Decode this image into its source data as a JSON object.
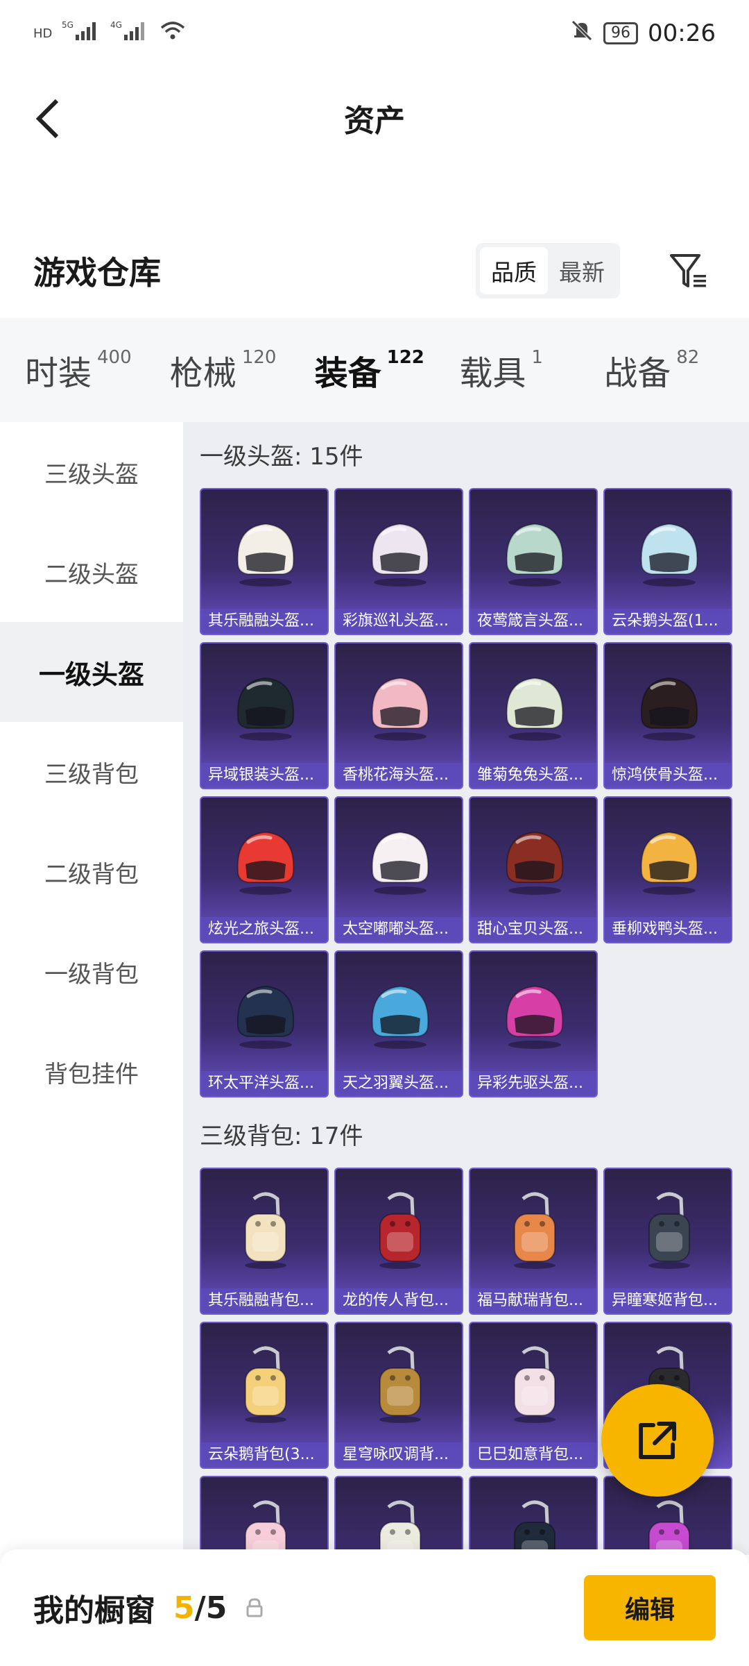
{
  "status_bar": {
    "left_tags": [
      "HD",
      "5G",
      "4G"
    ],
    "battery": "96",
    "time": "00:26"
  },
  "header": {
    "title": "资产"
  },
  "warehouse": {
    "title": "游戏仓库",
    "sort_options": [
      "品质",
      "最新"
    ],
    "active_sort": "品质"
  },
  "tabs": [
    {
      "label": "时装",
      "count": "400"
    },
    {
      "label": "枪械",
      "count": "120"
    },
    {
      "label": "装备",
      "count": "122"
    },
    {
      "label": "载具",
      "count": "1"
    },
    {
      "label": "战备",
      "count": "82"
    }
  ],
  "active_tab": "装备",
  "sidebar": {
    "items": [
      "三级头盔",
      "二级头盔",
      "一级头盔",
      "三级背包",
      "二级背包",
      "一级背包",
      "背包挂件"
    ],
    "active": "一级头盔"
  },
  "sections": [
    {
      "title": "一级头盔: 15件",
      "items": [
        {
          "label": "其乐融融头盔...",
          "icon": "helmet-white-icon",
          "color": "#f3efe6"
        },
        {
          "label": "彩旗巡礼头盔...",
          "icon": "helmet-cow-icon",
          "color": "#ece6f0"
        },
        {
          "label": "夜莺箴言头盔...",
          "icon": "helmet-teal-icon",
          "color": "#b8d8cc"
        },
        {
          "label": "云朵鹅头盔(1...",
          "icon": "helmet-blue-icon",
          "color": "#bfe2ef"
        },
        {
          "label": "异域银装头盔...",
          "icon": "helmet-black-icon",
          "color": "#1e2a30"
        },
        {
          "label": "香桃花海头盔...",
          "icon": "helmet-pink-icon",
          "color": "#f2b8c4"
        },
        {
          "label": "雏菊兔兔头盔...",
          "icon": "helmet-mint-icon",
          "color": "#dfe8d4"
        },
        {
          "label": "惊鸿侠骨头盔...",
          "icon": "helmet-darkred-icon",
          "color": "#2a1e20"
        },
        {
          "label": "炫光之旅头盔...",
          "icon": "helmet-red-icon",
          "color": "#e83a32"
        },
        {
          "label": "太空嘟嘟头盔...",
          "icon": "helmet-space-icon",
          "color": "#f6f0f3"
        },
        {
          "label": "甜心宝贝头盔...",
          "icon": "helmet-brown-icon",
          "color": "#8a2d22"
        },
        {
          "label": "垂柳戏鸭头盔...",
          "icon": "helmet-yellow-icon",
          "color": "#f3b340"
        },
        {
          "label": "环太平洋头盔...",
          "icon": "helmet-navy-icon",
          "color": "#22324f"
        },
        {
          "label": "天之羽翼头盔...",
          "icon": "helmet-sky-icon",
          "color": "#49a8dc"
        },
        {
          "label": "异彩先驱头盔...",
          "icon": "helmet-magenta-icon",
          "color": "#d63fa6"
        }
      ]
    },
    {
      "title": "三级背包: 17件",
      "items": [
        {
          "label": "其乐融融背包...",
          "icon": "backpack-cream-icon",
          "color": "#f2e2c0"
        },
        {
          "label": "龙的传人背包...",
          "icon": "backpack-red-icon",
          "color": "#b6262c"
        },
        {
          "label": "福马献瑞背包...",
          "icon": "backpack-horse-icon",
          "color": "#e7874a"
        },
        {
          "label": "异瞳寒姬背包...",
          "icon": "backpack-cat-icon",
          "color": "#3b4552"
        },
        {
          "label": "云朵鹅背包(3...",
          "icon": "backpack-goose-icon",
          "color": "#f4d07a"
        },
        {
          "label": "星穹咏叹调背...",
          "icon": "backpack-gold-icon",
          "color": "#b88a3c"
        },
        {
          "label": "巳巳如意背包...",
          "icon": "backpack-snake-icon",
          "color": "#f3dfe6"
        },
        {
          "label": "",
          "icon": "backpack-black-icon",
          "color": "#2b2b2f"
        },
        {
          "label": "",
          "icon": "backpack-pink-icon",
          "color": "#f6cdd8"
        },
        {
          "label": "",
          "icon": "backpack-white-icon",
          "color": "#ecebe0"
        },
        {
          "label": "",
          "icon": "backpack-bow-icon",
          "color": "#1f2a3a"
        },
        {
          "label": "",
          "icon": "backpack-purple-icon",
          "color": "#c64bd1"
        }
      ]
    }
  ],
  "showcase": {
    "label": "我的橱窗",
    "current": "5",
    "total": "/5",
    "edit_label": "编辑"
  },
  "colors": {
    "accent": "#f7b500",
    "card_bg": "#3c2d6f",
    "card_label_bg": "#5b4ab8"
  }
}
